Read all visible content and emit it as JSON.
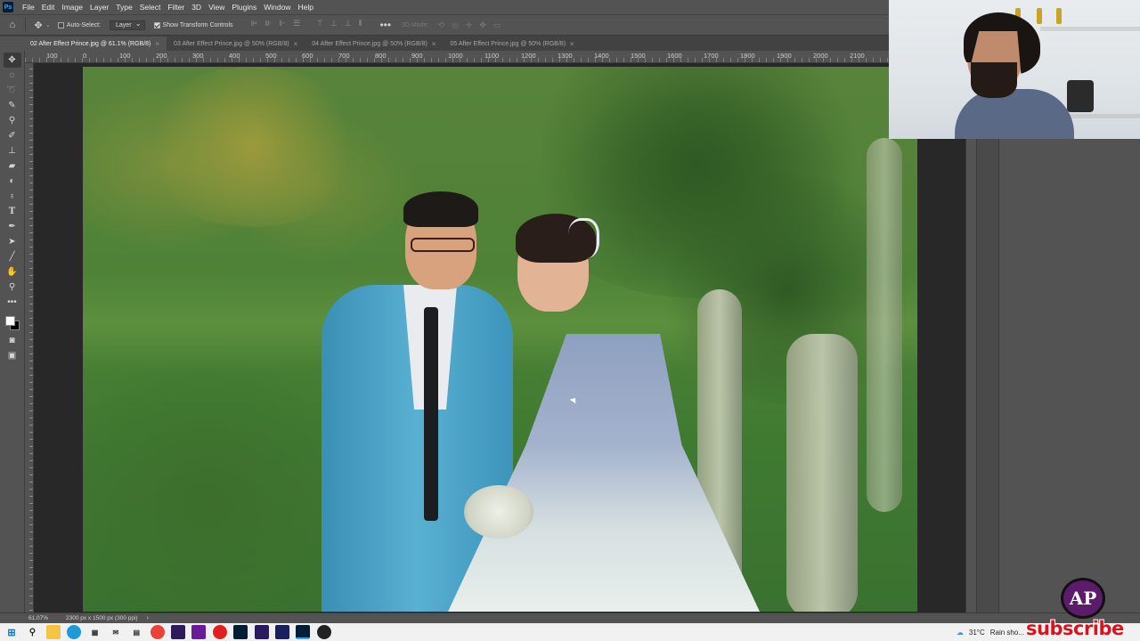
{
  "app": {
    "logo_text": "Ps"
  },
  "menu": [
    "File",
    "Edit",
    "Image",
    "Layer",
    "Type",
    "Select",
    "Filter",
    "3D",
    "View",
    "Plugins",
    "Window",
    "Help"
  ],
  "options": {
    "auto_select_label": "Auto-Select:",
    "layer_dropdown": "Layer",
    "show_transform_label": "Show Transform Controls",
    "mode_3d_label": "3D Mode:"
  },
  "tabs": [
    {
      "label": "02 After Effect Prince.jpg @ 61.1% (RGB/8)",
      "close": "×"
    },
    {
      "label": "03 After Effect Prince.jpg @ 50% (RGB/8)",
      "close": "×"
    },
    {
      "label": "04 After Effect Prince.jpg @ 50% (RGB/8)",
      "close": "×"
    },
    {
      "label": "05 After Effect Prince.jpg @ 50% (RGB/8)",
      "close": "×"
    }
  ],
  "ruler_labels": [
    "100",
    "0",
    "100",
    "200",
    "300",
    "400",
    "500",
    "600",
    "700",
    "800",
    "900",
    "1000",
    "1100",
    "1200",
    "1300",
    "1400",
    "1500",
    "1600",
    "1700",
    "1800",
    "1900",
    "2000",
    "2100"
  ],
  "status": {
    "zoom": "61.07%",
    "doc_info": "2300 px x 1500 px (300 ppi)",
    "arrow": "›"
  },
  "taskbar": {
    "temperature": "31°C",
    "weather": "Rain sho..."
  },
  "channel": {
    "logo_text": "AP",
    "subscribe_text": "subscribe"
  },
  "colors": {
    "foreground_swatch": "#ffffff",
    "background_swatch": "#000000",
    "subscribe_red": "#e0101b"
  }
}
